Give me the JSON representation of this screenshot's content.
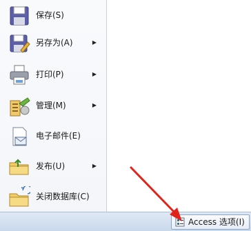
{
  "menu": {
    "items": [
      {
        "label": "保存(S)",
        "icon": "save-icon",
        "has_submenu": false
      },
      {
        "label": "另存为(A)",
        "icon": "save-as-icon",
        "has_submenu": true
      },
      {
        "label": "打印(P)",
        "icon": "print-icon",
        "has_submenu": true
      },
      {
        "label": "管理(M)",
        "icon": "manage-icon",
        "has_submenu": true
      },
      {
        "label": "电子邮件(E)",
        "icon": "email-icon",
        "has_submenu": false
      },
      {
        "label": "发布(U)",
        "icon": "publish-icon",
        "has_submenu": true
      },
      {
        "label": "关闭数据库(C)",
        "icon": "close-database-icon",
        "has_submenu": false
      }
    ],
    "submenu_arrow": "▶"
  },
  "footer": {
    "options_label": "Access 选项(I)",
    "options_icon": "options-icon"
  },
  "colors": {
    "annotation_arrow": "#e2231a",
    "footer_bg": "#d3e1f1",
    "menu_bg": "#f6f8fb"
  }
}
